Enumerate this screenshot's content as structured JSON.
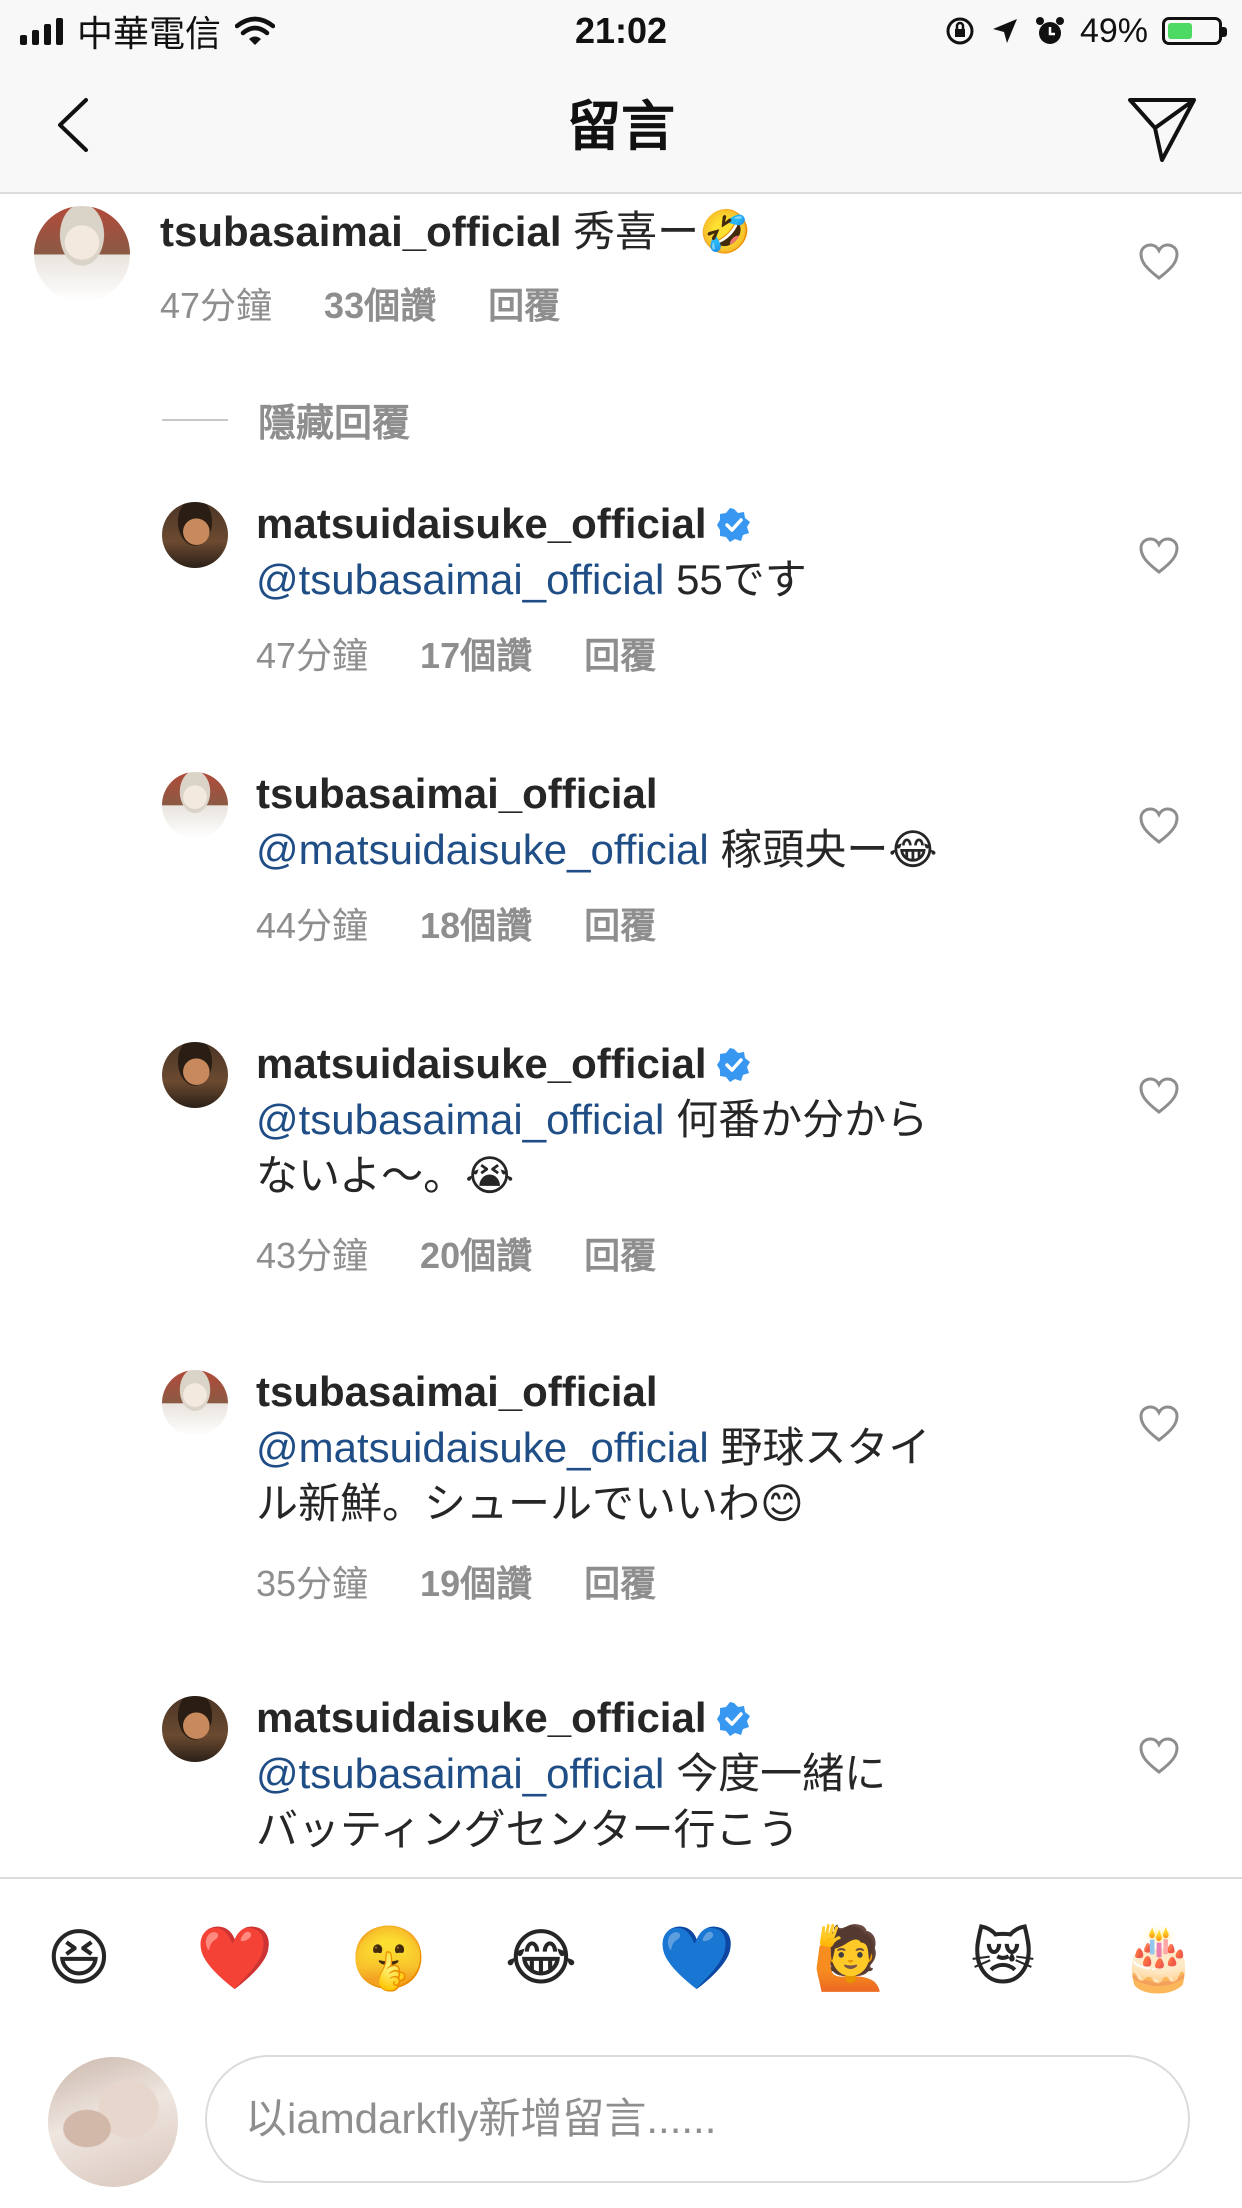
{
  "status_bar": {
    "carrier": "中華電信",
    "time": "21:02",
    "battery": "49%"
  },
  "header": {
    "title": "留言"
  },
  "parent_comment": {
    "username": "tsubasaimai_official",
    "text": "秀喜ー🤣",
    "time": "47分鐘",
    "likes": "33個讚",
    "reply_label": "回覆"
  },
  "hide_replies_label": "隱藏回覆",
  "replies": [
    {
      "username": "matsuidaisuke_official",
      "verified": true,
      "mention": "@tsubasaimai_official",
      "text_line1": " 55です",
      "text_line2": "",
      "time": "47分鐘",
      "likes": "17個讚",
      "reply_label": "回覆"
    },
    {
      "username": "tsubasaimai_official",
      "verified": false,
      "mention": "@matsuidaisuke_official",
      "text_line1": " 稼頭央ー😂",
      "text_line2": "",
      "time": "44分鐘",
      "likes": "18個讚",
      "reply_label": "回覆"
    },
    {
      "username": "matsuidaisuke_official",
      "verified": true,
      "mention": "@tsubasaimai_official",
      "text_line1": " 何番か分から",
      "text_line2": "ないよ～。😭",
      "time": "43分鐘",
      "likes": "20個讚",
      "reply_label": "回覆"
    },
    {
      "username": "tsubasaimai_official",
      "verified": false,
      "mention": "@matsuidaisuke_official",
      "text_line1": " 野球スタイ",
      "text_line2": "ル新鮮。シュールでいいわ😊",
      "time": "35分鐘",
      "likes": "19個讚",
      "reply_label": "回覆"
    },
    {
      "username": "matsuidaisuke_official",
      "verified": true,
      "mention": "@tsubasaimai_official",
      "text_line1": " 今度一緒に",
      "text_line2": "バッティングセンター行こう",
      "time": "",
      "likes": "",
      "reply_label": ""
    }
  ],
  "emoji_bar": [
    "😆",
    "❤️",
    "🤫",
    "😂",
    "💙",
    "🙋",
    "😿",
    "🎂"
  ],
  "compose": {
    "placeholder": "以iamdarkfly新增留言......"
  },
  "colors": {
    "mention": "#1f4d85",
    "verified": "#3897f0",
    "meta": "#8e8e8e",
    "border": "#dbdbdb"
  },
  "icons": [
    "signal-icon",
    "wifi-icon",
    "back-arrow-icon",
    "send-icon",
    "heart-icon",
    "verified-badge-icon",
    "lock-rotation-icon",
    "location-icon",
    "alarm-icon"
  ]
}
